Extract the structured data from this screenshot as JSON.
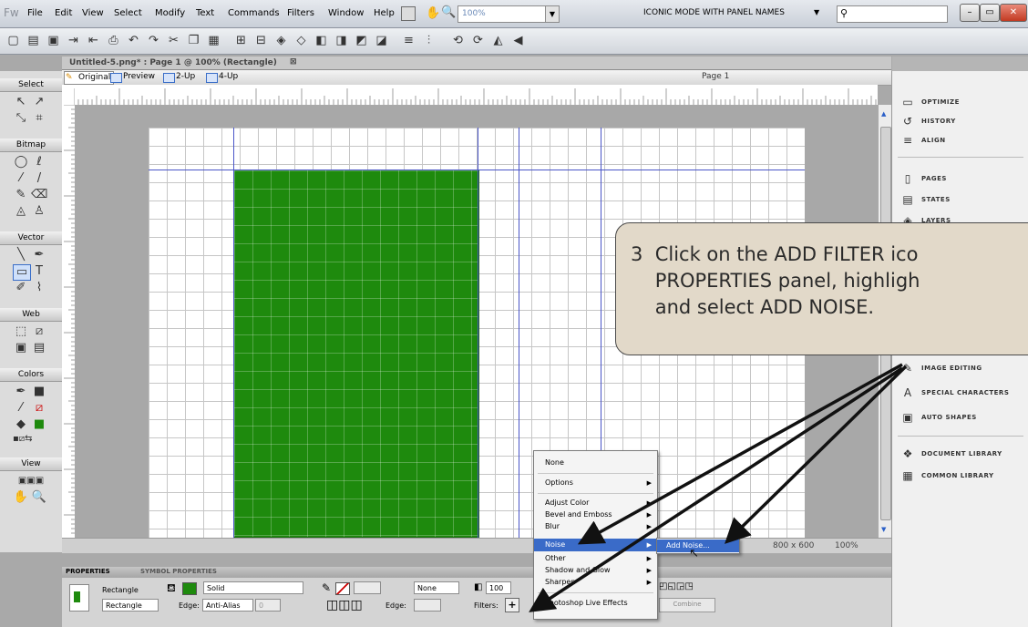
{
  "menubar": {
    "logo": "Fw",
    "items": [
      "File",
      "Edit",
      "View",
      "Select",
      "Modify",
      "Text",
      "Commands",
      "Filters",
      "Window",
      "Help"
    ],
    "zoom": "100%",
    "workspace": "ICONIC MODE WITH PANEL NAMES"
  },
  "document": {
    "tab_title": "Untitled-5.png* : Page 1 @ 100% (Rectangle)",
    "view_tabs": [
      "Original",
      "Preview",
      "2-Up",
      "4-Up"
    ],
    "page_selector": "Page 1"
  },
  "tools": {
    "groups": [
      "Select",
      "Bitmap",
      "Vector",
      "Web",
      "Colors",
      "View"
    ]
  },
  "status": {
    "page": "1",
    "size": "800 x 600",
    "zoom": "100%"
  },
  "properties": {
    "tabs": [
      "PROPERTIES",
      "SYMBOL PROPERTIES"
    ],
    "object_type": "Rectangle",
    "object_name": "Rectangle",
    "fill_type": "Solid",
    "edge_label": "Edge:",
    "edge_value": "Anti-Alias",
    "edge_value_num": "0",
    "stroke_type": "None",
    "edge2_label": "Edge:",
    "opacity": "100",
    "filters_label": "Filters:",
    "filters_add": "+",
    "combine_label": "Combine"
  },
  "right_panel": {
    "items": [
      "OPTIMIZE",
      "HISTORY",
      "ALIGN",
      "PAGES",
      "STATES",
      "LAYERS",
      "IMAGE EDITING",
      "SPECIAL CHARACTERS",
      "AUTO SHAPES",
      "DOCUMENT LIBRARY",
      "COMMON LIBRARY"
    ]
  },
  "callout": {
    "text": "3  Click on the ADD FILTER ico\n    PROPERTIES panel, highligh\n    and select ADD NOISE."
  },
  "context_menu": {
    "items": [
      "None",
      "Options",
      "Adjust Color",
      "Bevel and Emboss",
      "Blur",
      "Noise",
      "Other",
      "Shadow and Glow",
      "Sharpen",
      "Photoshop Live Effects"
    ],
    "submenu": [
      "Add Noise..."
    ]
  },
  "colors": {
    "fill": "#1e8a0d",
    "callout_bg": "#e2d9c9",
    "highlight": "#3a6bc8",
    "guide": "#4a55c8"
  }
}
